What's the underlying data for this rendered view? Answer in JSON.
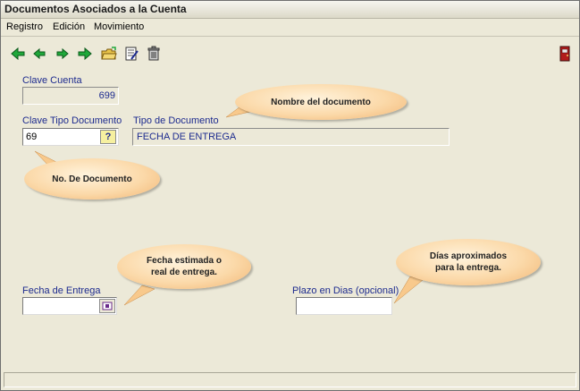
{
  "window": {
    "title": "Documentos Asociados a la Cuenta"
  },
  "menu": {
    "items": [
      "Registro",
      "Edición",
      "Movimiento"
    ]
  },
  "toolbar": {
    "icons": [
      "arrow-first-icon",
      "arrow-left-icon",
      "arrow-right-icon",
      "arrow-last-icon",
      "open-folder-icon",
      "edit-document-icon",
      "trash-icon",
      "exit-door-icon"
    ],
    "accent_color": "#1a7a2a"
  },
  "form": {
    "clave_cuenta_label": "Clave Cuenta",
    "clave_cuenta_value": "699",
    "clave_tipo_label": "Clave Tipo Documento",
    "clave_tipo_value": "69",
    "lookup_button": "?",
    "tipo_documento_label": "Tipo de Documento",
    "tipo_documento_value": "FECHA DE ENTREGA",
    "fecha_entrega_label": "Fecha de Entrega",
    "fecha_entrega_value": "",
    "plazo_label": "Plazo en Dias (opcional)",
    "plazo_value": ""
  },
  "callouts": {
    "nombre": "Nombre del documento",
    "numero": "No. De Documento",
    "fecha_line1": "Fecha estimada o",
    "fecha_line2": "real de entrega.",
    "dias_line1": "Días aproximados",
    "dias_line2": "para la entrega."
  },
  "colors": {
    "label_blue": "#1d2b8f",
    "bubble": "#fbd9a9",
    "window_bg": "#ece9d8"
  }
}
